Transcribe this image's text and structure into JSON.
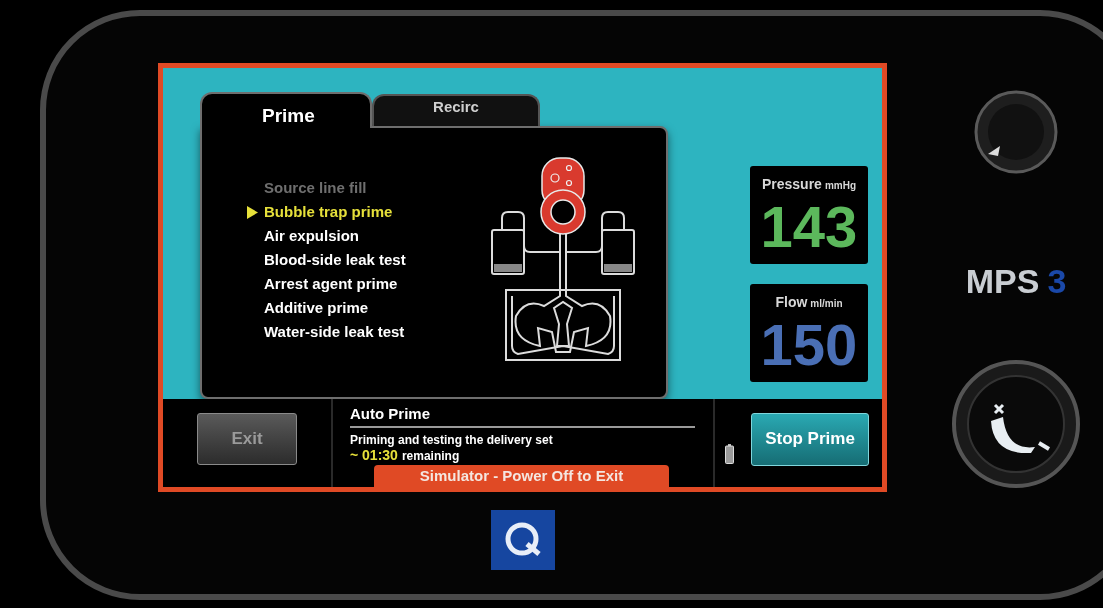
{
  "tabs": [
    {
      "label": "Prime",
      "selected": true
    },
    {
      "label": "Recirc",
      "selected": false
    }
  ],
  "steps": [
    {
      "label": "Source line fill",
      "completed": true,
      "current": false
    },
    {
      "label": "Bubble trap prime",
      "completed": false,
      "current": true
    },
    {
      "label": "Air expulsion",
      "completed": false,
      "current": false
    },
    {
      "label": "Blood-side leak test",
      "completed": false,
      "current": false
    },
    {
      "label": "Arrest agent prime",
      "completed": false,
      "current": false
    },
    {
      "label": "Additive prime",
      "completed": false,
      "current": false
    },
    {
      "label": "Water-side leak test",
      "completed": false,
      "current": false
    }
  ],
  "readouts": [
    {
      "label": "Pressure",
      "unit": "mmHg",
      "value": "143",
      "color": "#5cb85c"
    },
    {
      "label": "Flow",
      "unit": "ml/min",
      "value": "150",
      "color": "#4a6fb5"
    }
  ],
  "exit_button": {
    "label": "Exit",
    "disabled": true
  },
  "status": {
    "title": "Auto Prime",
    "message": "Priming and testing the delivery set",
    "time": "~ 01:30",
    "time_suffix": "remaining"
  },
  "action_button": {
    "label": "Stop Prime"
  },
  "banner": "Simulator - Power Off to Exit",
  "device": {
    "brand": "MPS",
    "model": "3"
  }
}
